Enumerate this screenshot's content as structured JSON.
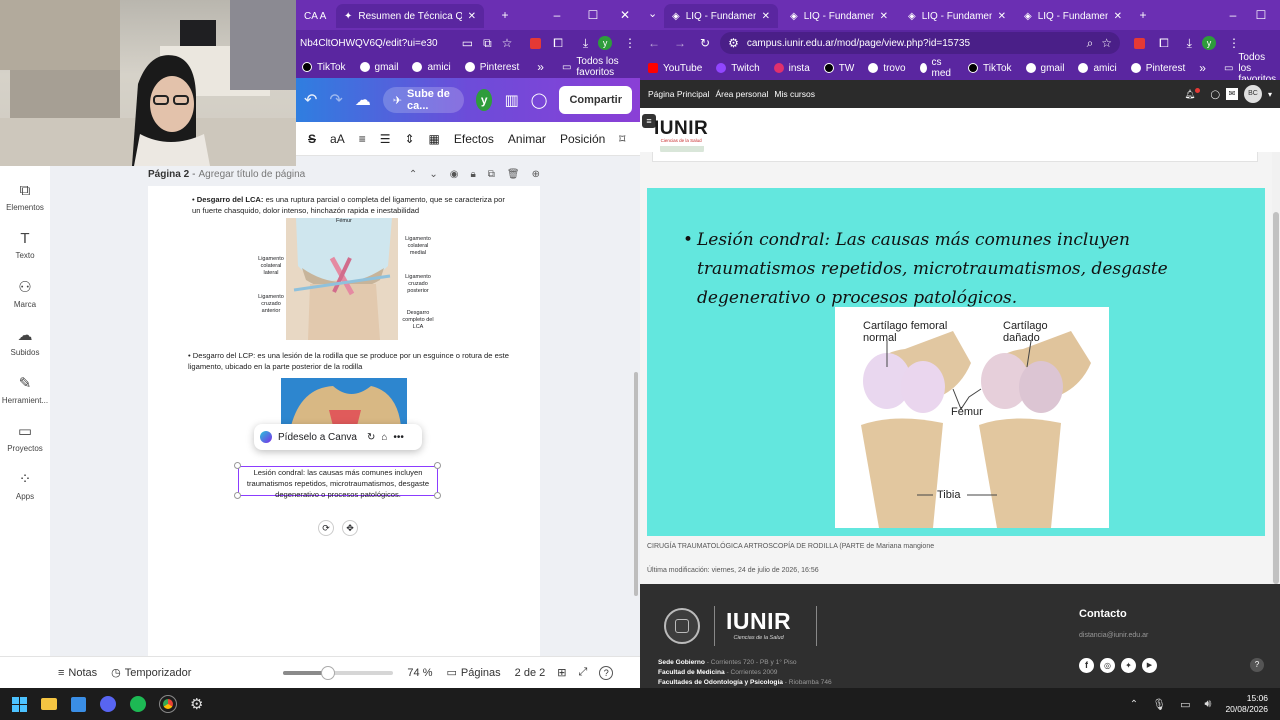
{
  "left_browser": {
    "tabs": [
      {
        "label": "CA A",
        "active": false
      },
      {
        "label": "Resumen de Técnica Quirúrgic",
        "active": true
      }
    ],
    "url": "Nb4CltOHWQV6Q/edit?ui=e30",
    "bookmarks": [
      "TikTok",
      "gmail",
      "amici",
      "Pinterest"
    ],
    "all_bookmarks": "Todos los favoritos",
    "profile_initial": "y"
  },
  "canva": {
    "upload_label": "Sube de ca...",
    "avatar_initial": "y",
    "share_label": "Compartir",
    "toolbar": {
      "font_size": "aA",
      "effects": "Efectos",
      "animate": "Animar",
      "position": "Posición"
    },
    "sidebar": [
      {
        "label": "Elementos",
        "icon": "shapes-icon"
      },
      {
        "label": "Texto",
        "icon": "text-icon"
      },
      {
        "label": "Marca",
        "icon": "brand-icon"
      },
      {
        "label": "Subidos",
        "icon": "upload-cloud-icon"
      },
      {
        "label": "Herramient...",
        "icon": "draw-tool-icon"
      },
      {
        "label": "Proyectos",
        "icon": "folder-icon"
      },
      {
        "label": "Apps",
        "icon": "apps-icon"
      }
    ],
    "page_label": "Página 2",
    "page_title_placeholder": "Agregar título de página",
    "doc": {
      "b1_bold": "Desgarro del LCA:",
      "b1_text": " es una ruptura parcial o completa del ligamento, que se caracteriza por un fuerte chasquido, dolor intenso, hinchazón rapida e inestabilidad",
      "knee_labels": {
        "femur": "Fémur",
        "lig_colat_lat": "Ligamento colateral lateral",
        "lig_cruz_ant": "Ligamento cruzado anterior",
        "lig_colat_med": "Ligamento colateral medial",
        "lig_cruz_post": "Ligamento cruzado posterior",
        "desgarro": "Desgarro completo del LCA"
      },
      "b2_text": "Desgarro del LCP: es una lesión de la rodilla que se produce por un esguince o rotura de este ligamento, ubicado en la parte posterior de la rodilla",
      "ask_canva": "Pídeselo a Canva",
      "selected_text": "Lesión condral: las causas más comunes incluyen traumatismos repetidos, microtraumatismos, desgaste degenerativo o procesos patológicos."
    },
    "bottom": {
      "notes": "Notas",
      "timer": "Temporizador",
      "zoom": "74 %",
      "pages": "Páginas",
      "page_count": "2 de 2",
      "zoom_value": 0.74
    }
  },
  "right_browser": {
    "tabs": [
      {
        "label": "LIQ - Fundamentos",
        "active": true
      },
      {
        "label": "LIQ - Fundamentos",
        "active": false
      },
      {
        "label": "LIQ - Fundamentos",
        "active": false
      },
      {
        "label": "LIQ - Fundamentos",
        "active": false
      }
    ],
    "url": "campus.iunir.edu.ar/mod/page/view.php?id=15735",
    "bookmarks": [
      "YouTube",
      "Twitch",
      "insta",
      "TW",
      "trovo",
      "cs med",
      "TikTok",
      "gmail",
      "amici",
      "Pinterest"
    ],
    "all_bookmarks": "Todos los favoritos",
    "profile_initial": "y"
  },
  "moodle": {
    "nav": [
      "Página Principal",
      "Área personal",
      "Mis cursos"
    ],
    "user_initials": "BC",
    "logo": "IUNIR",
    "logo_sub": "Ciencias de la Salud",
    "slide": {
      "bullet": "Lesión condral: Las causas más comunes incluyen traumatismos repetidos, microtraumatismos, desgaste degenerativo o procesos patológicos.",
      "label_normal": "Cartílago femoral normal",
      "label_damaged": "Cartílago dañado",
      "label_femur": "Fémur",
      "label_tibia": "Tibia"
    },
    "caption_main": "CIRUGÍA TRAUMATOLÓGICA ARTROSCOPÍA DE RODILLA (PARTE",
    "caption_by": " de Mariana mangione",
    "last_modified": "Última modificación: viernes, 24 de julio de 2026, 16:56",
    "footer": {
      "contact_title": "Contacto",
      "contact_email": "distancia@iunir.edu.ar",
      "lines": [
        {
          "bold": "Sede Gobierno",
          "rest": " - Corrientes 720 - PB y 1° Piso"
        },
        {
          "bold": "Facultad de Medicina",
          "rest": " - Corrientes 2009"
        },
        {
          "bold": "Facultades de Odontología y Psicología",
          "rest": " - Riobamba 746"
        }
      ]
    }
  },
  "taskbar": {
    "time": "15:06",
    "date": "20/08/2026"
  },
  "colors": {
    "browser_purple": "#6b2fb3",
    "canva_purple": "#7d2ae8",
    "slide_cyan": "#63e7de",
    "footer_dark": "#2f2f2f"
  }
}
